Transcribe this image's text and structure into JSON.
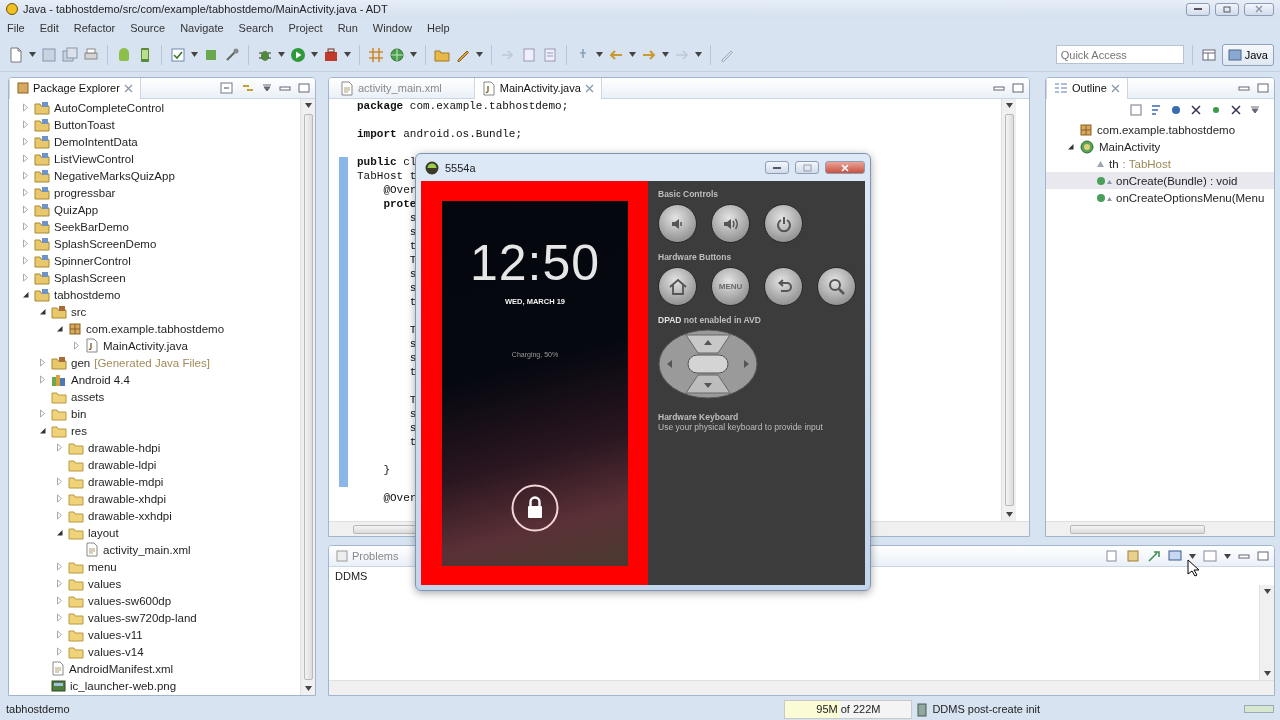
{
  "window": {
    "title": "Java - tabhostdemo/src/com/example/tabhostdemo/MainActivity.java - ADT"
  },
  "menu": [
    "File",
    "Edit",
    "Refactor",
    "Source",
    "Navigate",
    "Search",
    "Project",
    "Run",
    "Window",
    "Help"
  ],
  "quick_access": {
    "placeholder": "Quick Access"
  },
  "perspective": {
    "label": "Java",
    "selected": true
  },
  "package_explorer": {
    "title": "Package Explorer",
    "items": [
      {
        "label": "AutoCompleteControl",
        "kind": "project",
        "expanded": false
      },
      {
        "label": "ButtonToast",
        "kind": "project",
        "expanded": false
      },
      {
        "label": "DemoIntentData",
        "kind": "project",
        "expanded": false
      },
      {
        "label": "ListViewControl",
        "kind": "project",
        "expanded": false
      },
      {
        "label": "NegativeMarksQuizApp",
        "kind": "project",
        "expanded": false
      },
      {
        "label": "progressbar",
        "kind": "project",
        "expanded": false
      },
      {
        "label": "QuizApp",
        "kind": "project",
        "expanded": false
      },
      {
        "label": "SeekBarDemo",
        "kind": "project",
        "expanded": false
      },
      {
        "label": "SplashScreenDemo",
        "kind": "project",
        "expanded": false
      },
      {
        "label": "SpinnerControl",
        "kind": "project",
        "expanded": false
      },
      {
        "label": "SplashScreen",
        "kind": "project",
        "expanded": false
      },
      {
        "label": "tabhostdemo",
        "kind": "project",
        "expanded": true,
        "children": [
          {
            "label": "src",
            "kind": "src",
            "expanded": true,
            "children": [
              {
                "label": "com.example.tabhostdemo",
                "kind": "package",
                "expanded": true,
                "children": [
                  {
                    "label": "MainActivity.java",
                    "kind": "java-file",
                    "expanded": false
                  }
                ]
              }
            ]
          },
          {
            "label": "gen",
            "note": "[Generated Java Files]",
            "kind": "src",
            "expanded": false
          },
          {
            "label": "Android 4.4",
            "kind": "library",
            "expanded": false
          },
          {
            "label": "assets",
            "kind": "folder"
          },
          {
            "label": "bin",
            "kind": "folder",
            "expanded": false
          },
          {
            "label": "res",
            "kind": "folder",
            "expanded": true,
            "children": [
              {
                "label": "drawable-hdpi",
                "kind": "folder",
                "expanded": false
              },
              {
                "label": "drawable-ldpi",
                "kind": "folder"
              },
              {
                "label": "drawable-mdpi",
                "kind": "folder",
                "expanded": false
              },
              {
                "label": "drawable-xhdpi",
                "kind": "folder",
                "expanded": false
              },
              {
                "label": "drawable-xxhdpi",
                "kind": "folder",
                "expanded": false
              },
              {
                "label": "layout",
                "kind": "folder",
                "expanded": true,
                "children": [
                  {
                    "label": "activity_main.xml",
                    "kind": "xml-file"
                  }
                ]
              },
              {
                "label": "menu",
                "kind": "folder",
                "expanded": false
              },
              {
                "label": "values",
                "kind": "folder",
                "expanded": false
              },
              {
                "label": "values-sw600dp",
                "kind": "folder",
                "expanded": false
              },
              {
                "label": "values-sw720dp-land",
                "kind": "folder",
                "expanded": false
              },
              {
                "label": "values-v11",
                "kind": "folder",
                "expanded": false
              },
              {
                "label": "values-v14",
                "kind": "folder",
                "expanded": false
              }
            ]
          },
          {
            "label": "AndroidManifest.xml",
            "kind": "xml-file"
          },
          {
            "label": "ic_launcher-web.png",
            "kind": "image-file"
          }
        ]
      }
    ]
  },
  "editor": {
    "tabs": [
      {
        "label": "activity_main.xml",
        "selected": false
      },
      {
        "label": "MainActivity.java",
        "selected": true
      }
    ],
    "blocks": [
      [
        "**package** com.example.tabhostdemo;"
      ],
      [
        "**import** android.os.Bundle;"
      ],
      [
        "**public** cl",
        "TabHost t",
        "    @Over",
        "    **prote**",
        "        s",
        "        s",
        "        t",
        "        T",
        "        s",
        "        s",
        "        t"
      ],
      [
        "        T",
        "        s",
        "        s",
        "        t"
      ],
      [
        "        T",
        "        s",
        "        s",
        "        t"
      ],
      [
        "    }"
      ],
      [
        "    @Over"
      ]
    ]
  },
  "outline": {
    "title": "Outline",
    "items": [
      {
        "label": "com.example.tabhostdemo",
        "kind": "package",
        "selected": false
      },
      {
        "label": "MainActivity",
        "kind": "class",
        "selected": false,
        "expanded": true,
        "children": [
          {
            "label": "th",
            "type": ": TabHost",
            "kind": "field",
            "selected": false
          },
          {
            "label": "onCreate(Bundle) : void",
            "kind": "method",
            "selected": true
          },
          {
            "label": "onCreateOptionsMenu(Menu",
            "kind": "method",
            "selected": false
          }
        ]
      }
    ]
  },
  "bottom_panel": {
    "tabs": [
      {
        "label": "Problems",
        "selected": false
      }
    ],
    "console_name": "DDMS"
  },
  "emulator": {
    "title": "5554a",
    "screen": {
      "time": "12:50",
      "date": "WED, MARCH 19",
      "charging": "Charging, 50%"
    },
    "basic_controls": {
      "title": "Basic Controls"
    },
    "hardware_buttons": {
      "title": "Hardware Buttons",
      "menu_label": "MENU"
    },
    "dpad": {
      "title": "**DPAD** not enabled in AVD"
    },
    "keyboard": {
      "title": "Hardware Keyboard",
      "hint": "Use your physical keyboard to provide input"
    }
  },
  "status_bar": {
    "selection": "tabhostdemo",
    "heap": {
      "text": "95M of 222M",
      "level": 0.43
    },
    "message": "DDMS post-create init"
  }
}
